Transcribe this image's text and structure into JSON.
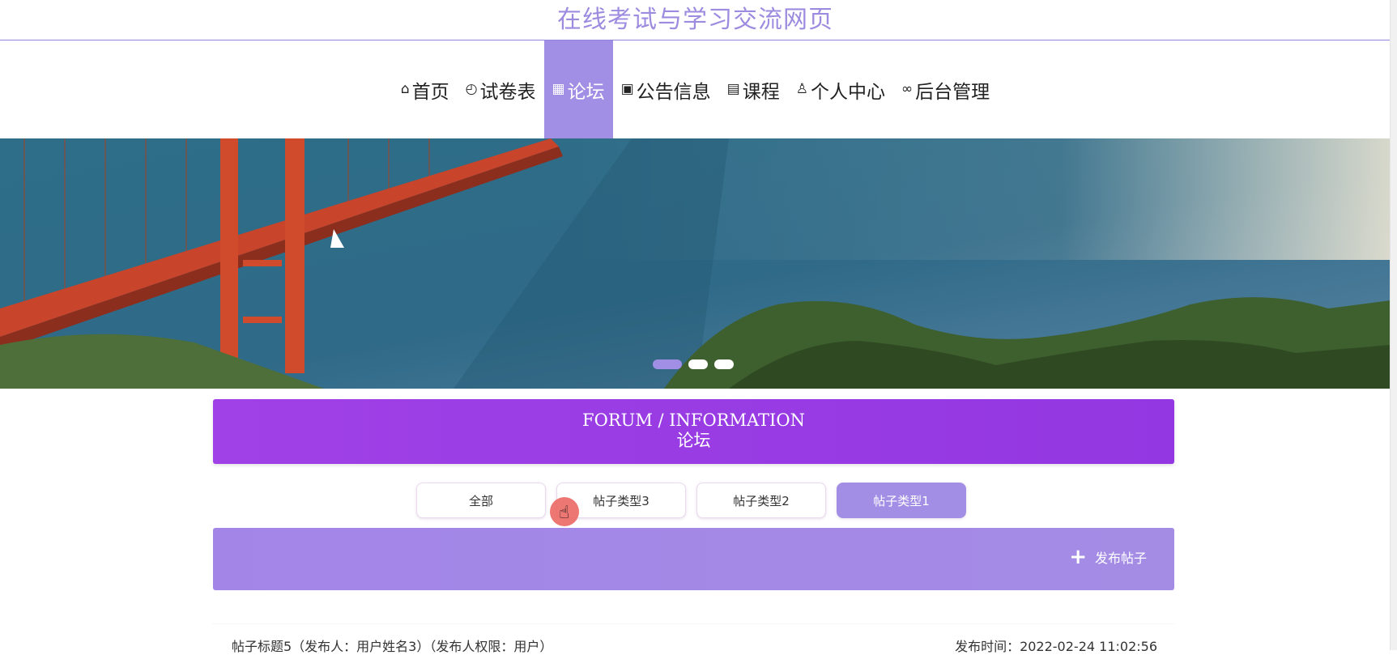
{
  "site": {
    "title": "在线考试与学习交流网页"
  },
  "nav": [
    {
      "icon": "home-icon",
      "glyph": "⌂",
      "label": "首页"
    },
    {
      "icon": "gauge-icon",
      "glyph": "◴",
      "label": "试卷表"
    },
    {
      "icon": "grid-icon",
      "glyph": "▦",
      "label": "论坛"
    },
    {
      "icon": "notice-icon",
      "glyph": "▣",
      "label": "公告信息"
    },
    {
      "icon": "clipboard-icon",
      "glyph": "▤",
      "label": "课程"
    },
    {
      "icon": "user-icon",
      "glyph": "♙",
      "label": "个人中心"
    },
    {
      "icon": "link-icon",
      "glyph": "∞",
      "label": "后台管理"
    }
  ],
  "forum": {
    "title_en": "FORUM / INFORMATION",
    "title_cn": "论坛"
  },
  "filters": [
    "全部",
    "帖子类型3",
    "帖子类型2",
    "帖子类型1"
  ],
  "post_button": {
    "label": "发布帖子",
    "icon": "plus-icon"
  },
  "post": {
    "title": "帖子标题5（发布人：用户姓名3）（发布人权限：用户）",
    "time": "发布时间：2022-02-24 11:02:56"
  },
  "colors": {
    "accent": "#a08fe4",
    "forum_header": "#9c3fe6",
    "title": "#9d8be0"
  }
}
